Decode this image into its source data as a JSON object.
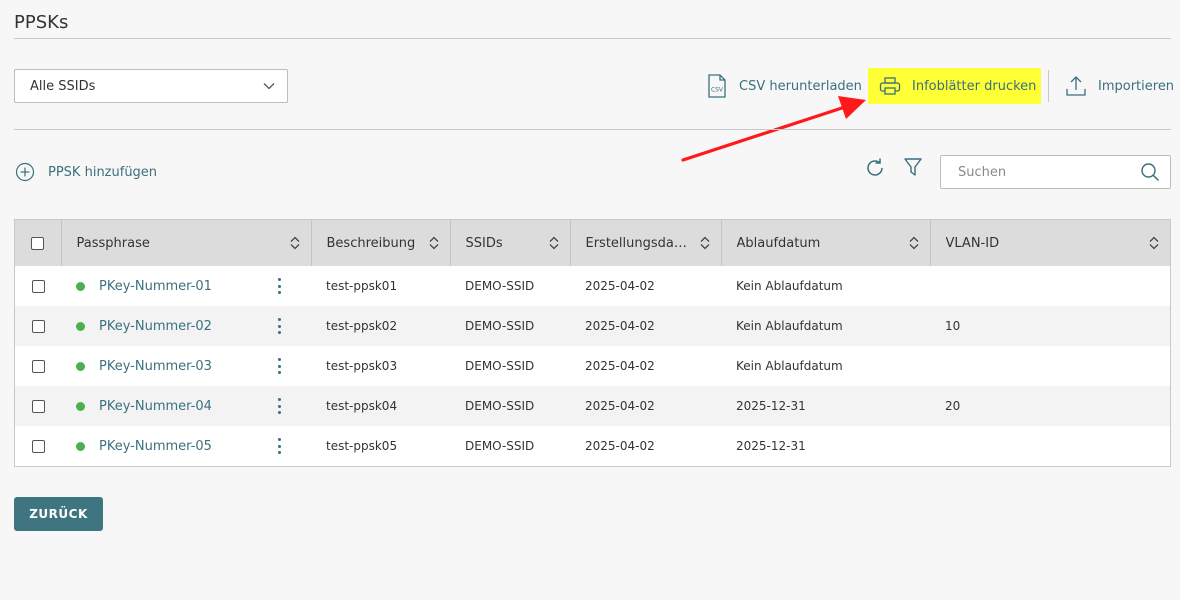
{
  "page": {
    "title": "PPSKs"
  },
  "ssid_filter": {
    "selected": "Alle SSIDs"
  },
  "toolbar": {
    "csv_label": "CSV herunterladen",
    "csv_icon_text": "CSV",
    "print_label": "Infoblätter drucken",
    "import_label": "Importieren"
  },
  "actions": {
    "add_label": "PPSK hinzufügen",
    "search_placeholder": "Suchen"
  },
  "table": {
    "headers": [
      "Passphrase",
      "Beschreibung",
      "SSIDs",
      "Erstellungsdatum",
      "Ablaufdatum",
      "VLAN-ID"
    ],
    "rows": [
      {
        "passphrase": "PKey-Nummer-01",
        "description": "test-ppsk01",
        "ssids": "DEMO-SSID",
        "created": "2025-04-02",
        "expires": "Kein Ablaufdatum",
        "vlan": ""
      },
      {
        "passphrase": "PKey-Nummer-02",
        "description": "test-ppsk02",
        "ssids": "DEMO-SSID",
        "created": "2025-04-02",
        "expires": "Kein Ablaufdatum",
        "vlan": "10"
      },
      {
        "passphrase": "PKey-Nummer-03",
        "description": "test-ppsk03",
        "ssids": "DEMO-SSID",
        "created": "2025-04-02",
        "expires": "Kein Ablaufdatum",
        "vlan": ""
      },
      {
        "passphrase": "PKey-Nummer-04",
        "description": "test-ppsk04",
        "ssids": "DEMO-SSID",
        "created": "2025-04-02",
        "expires": "2025-12-31",
        "vlan": "20"
      },
      {
        "passphrase": "PKey-Nummer-05",
        "description": "test-ppsk05",
        "ssids": "DEMO-SSID",
        "created": "2025-04-02",
        "expires": "2025-12-31",
        "vlan": ""
      }
    ]
  },
  "footer": {
    "back_label": "ZURÜCK"
  },
  "colors": {
    "accent": "#3a6f7e",
    "highlight": "#ffff35",
    "arrow": "#ff1a1a",
    "status_active": "#4caf50",
    "button": "#3f7581"
  },
  "icons": {
    "select": "chevron-down-icon",
    "csv": "csv-file-icon",
    "print": "printer-icon",
    "import": "upload-icon",
    "add": "plus-circle-icon",
    "refresh": "refresh-icon",
    "filter": "filter-icon",
    "search": "search-icon",
    "sort": "sort-icon",
    "row_menu": "kebab-menu-icon"
  }
}
